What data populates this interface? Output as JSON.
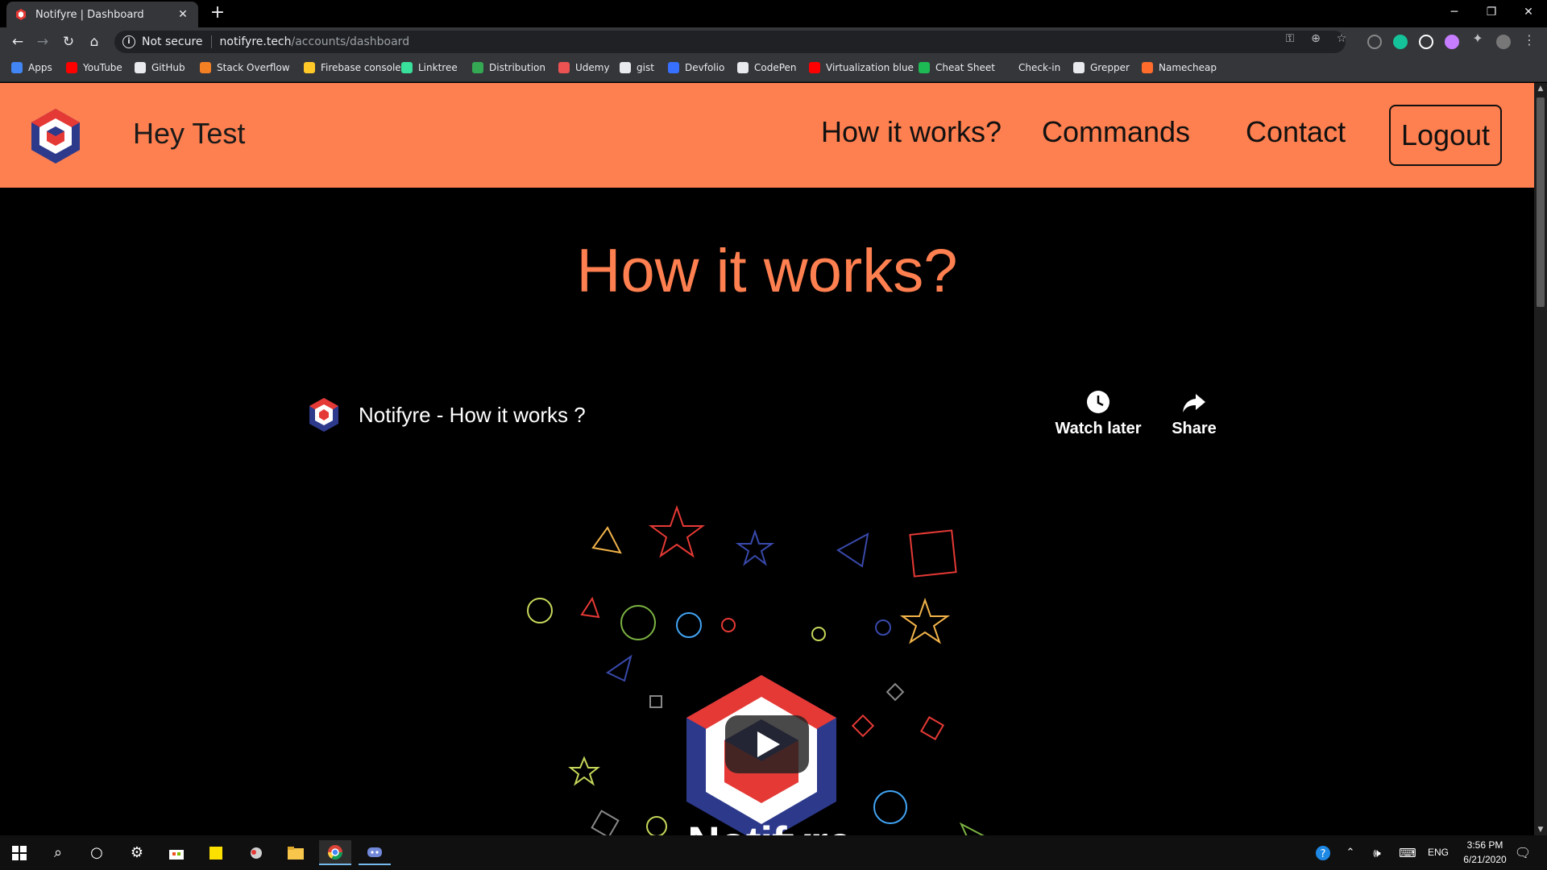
{
  "browser": {
    "tab_title": "Notifyre | Dashboard",
    "security_label": "Not secure",
    "url_host": "notifyre.tech",
    "url_path": "/accounts/dashboard",
    "bookmarks": [
      {
        "label": "Apps",
        "icon": "apps-grid-icon",
        "color": "#4285f4"
      },
      {
        "label": "YouTube",
        "icon": "youtube-icon",
        "color": "#ff0000"
      },
      {
        "label": "GitHub",
        "icon": "github-icon",
        "color": "#e8eaed"
      },
      {
        "label": "Stack Overflow",
        "icon": "stackoverflow-icon",
        "color": "#f48024"
      },
      {
        "label": "Firebase console",
        "icon": "firebase-icon",
        "color": "#ffca28"
      },
      {
        "label": "Linktree",
        "icon": "linktree-icon",
        "color": "#39e09b"
      },
      {
        "label": "Distribution",
        "icon": "distribution-icon",
        "color": "#34a853"
      },
      {
        "label": "Udemy",
        "icon": "udemy-icon",
        "color": "#ec5252"
      },
      {
        "label": "gist",
        "icon": "github-icon",
        "color": "#e8eaed"
      },
      {
        "label": "Devfolio",
        "icon": "devfolio-icon",
        "color": "#3770ff"
      },
      {
        "label": "CodePen",
        "icon": "codepen-icon",
        "color": "#e8eaed"
      },
      {
        "label": "Virtualization blue",
        "icon": "youtube-icon",
        "color": "#ff0000"
      },
      {
        "label": "Cheat Sheet",
        "icon": "cheatsheet-icon",
        "color": "#1db954"
      },
      {
        "label": "Check-in",
        "icon": "checkin-icon",
        "color": "#35363a"
      },
      {
        "label": "Grepper",
        "icon": "grepper-icon",
        "color": "#e8eaed"
      },
      {
        "label": "Namecheap",
        "icon": "namecheap-icon",
        "color": "#ff6c2c"
      }
    ]
  },
  "site": {
    "greeting": "Hey Test",
    "nav": [
      "How it works?",
      "Commands",
      "Contact"
    ],
    "logout_label": "Logout",
    "accent_color": "#fe7f4f",
    "section_title": "How it works?"
  },
  "video": {
    "title": "Notifyre - How it works ?",
    "watch_later_label": "Watch later",
    "share_label": "Share",
    "brand_name": "Notifyre"
  },
  "taskbar": {
    "time": "3:56 PM",
    "date": "6/21/2020",
    "language": "ENG"
  }
}
